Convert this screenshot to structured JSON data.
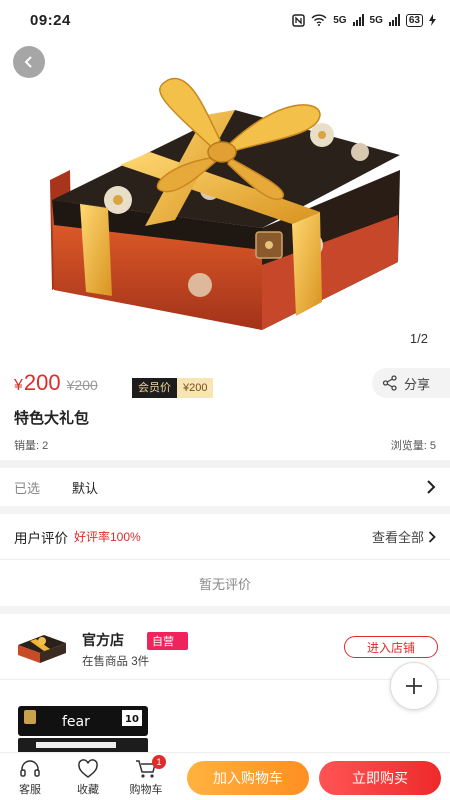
{
  "status_bar": {
    "time": "09:24",
    "battery": "63",
    "network_1": "5G",
    "network_2": "5G"
  },
  "gallery": {
    "pager": "1/2",
    "image_icon": "gift-box-image"
  },
  "product": {
    "currency": "¥",
    "price": "200",
    "original_price": "¥200",
    "member_label": "会员价",
    "member_price": "¥200",
    "share_label": "分享",
    "title": "特色大礼包",
    "sales": "销量: 2",
    "views": "浏览量: 5"
  },
  "spec": {
    "label": "已选",
    "value": "默认"
  },
  "reviews": {
    "title": "用户评价",
    "rate": "好评率100%",
    "view_all": "查看全部",
    "empty": "暂无评价"
  },
  "shop": {
    "name": "官方店",
    "badge": "自营",
    "count": "在售商品 3件",
    "enter": "进入店铺"
  },
  "recommend": {
    "brand": "fear",
    "count": "10"
  },
  "bottom_bar": {
    "service": "客服",
    "favorite": "收藏",
    "cart": "购物车",
    "cart_count": "1",
    "add_to_cart": "加入购物车",
    "buy_now": "立即购买"
  },
  "colors": {
    "accent": "#e02b2b",
    "cart_btn": "#ff9a2a",
    "self_badge": "#f0245c",
    "ribbon": "#f0b53a"
  }
}
